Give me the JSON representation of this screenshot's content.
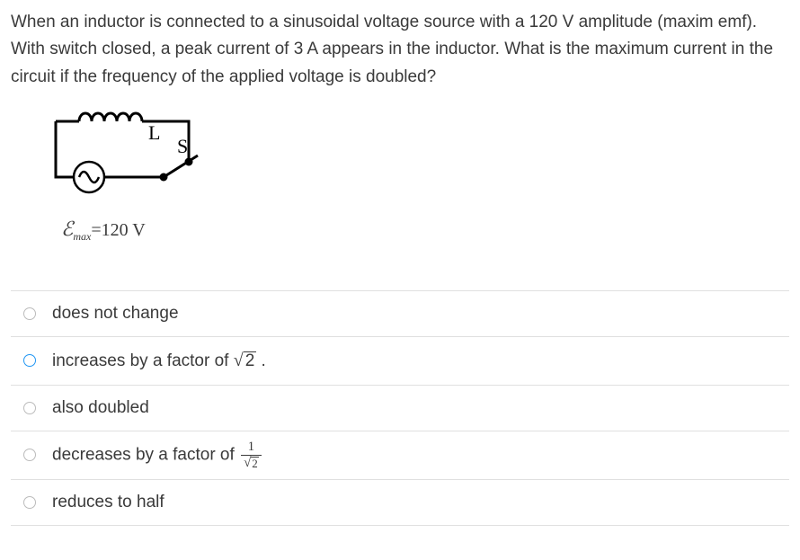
{
  "question": {
    "text": "When an inductor is connected to a sinusoidal voltage source with a 120 V amplitude (maxim emf). With switch closed, a peak current of 3 A appears in the inductor. What is the maximum current in the circuit if the frequency of the applied voltage is doubled?"
  },
  "circuit": {
    "inductor_label": "L",
    "switch_label": "S",
    "emf_symbol": "ℰ",
    "emf_sub": "max",
    "emf_value": "=120 V"
  },
  "options": [
    {
      "id": "opt1",
      "text": "does not change",
      "type": "plain"
    },
    {
      "id": "opt2",
      "prefix": "increases by a factor of ",
      "sqrt_arg": "2",
      "suffix": " .",
      "type": "sqrt"
    },
    {
      "id": "opt3",
      "text": "also doubled",
      "type": "plain"
    },
    {
      "id": "opt4",
      "prefix": "decreases by a factor of ",
      "frac_num": "1",
      "frac_den_sqrt": "2",
      "type": "frac"
    },
    {
      "id": "opt5",
      "text": "reduces to half",
      "type": "plain"
    }
  ]
}
